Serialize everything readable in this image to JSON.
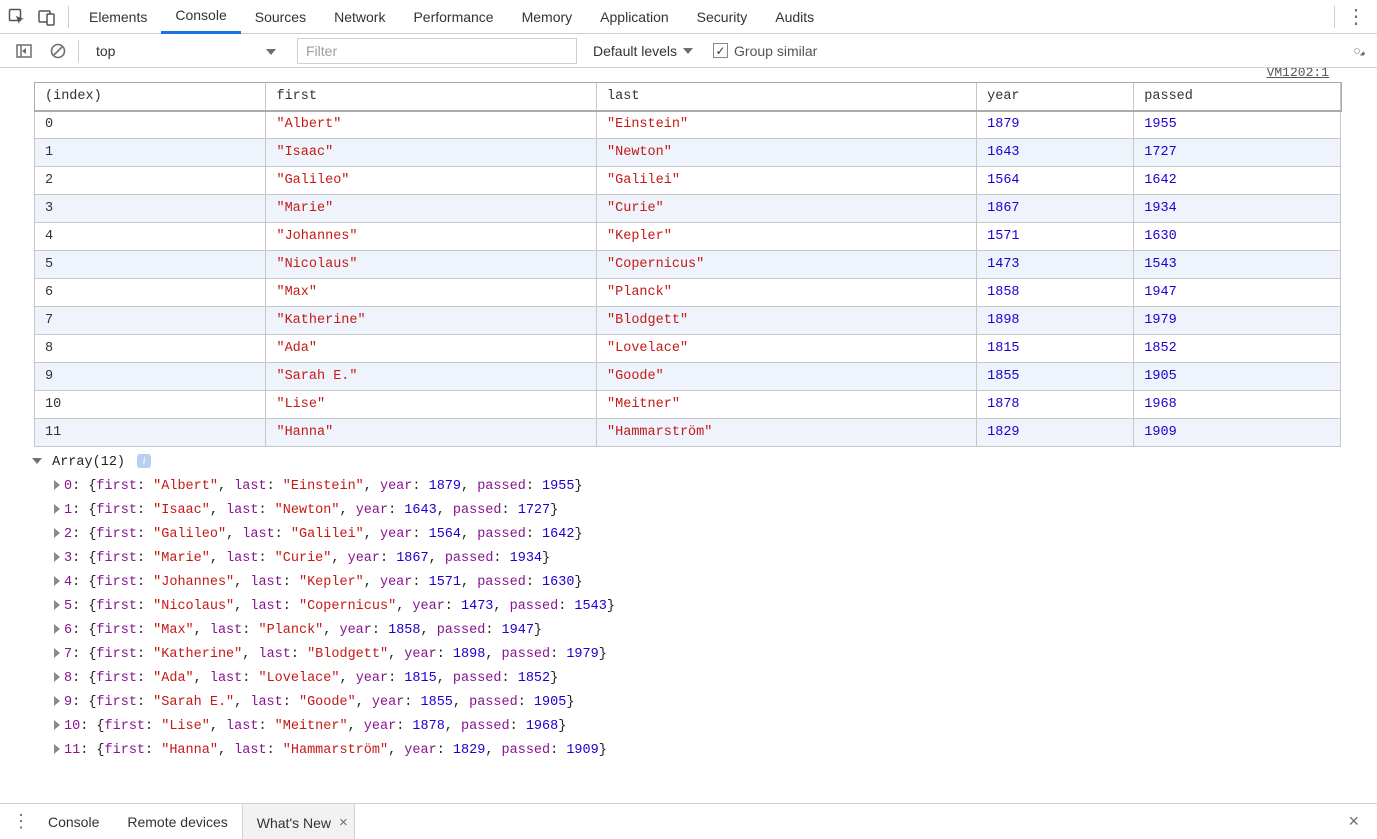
{
  "main_tabs": [
    "Elements",
    "Console",
    "Sources",
    "Network",
    "Performance",
    "Memory",
    "Application",
    "Security",
    "Audits"
  ],
  "main_tabs_active": 1,
  "toolbar": {
    "context": "top",
    "filter_placeholder": "Filter",
    "levels_label": "Default levels",
    "group_similar_label": "Group similar",
    "group_similar_checked": true
  },
  "source_link": "VM1202:1",
  "table": {
    "columns": [
      "(index)",
      "first",
      "last",
      "year",
      "passed"
    ],
    "rows": [
      {
        "index": 0,
        "first": "Albert",
        "last": "Einstein",
        "year": 1879,
        "passed": 1955
      },
      {
        "index": 1,
        "first": "Isaac",
        "last": "Newton",
        "year": 1643,
        "passed": 1727
      },
      {
        "index": 2,
        "first": "Galileo",
        "last": "Galilei",
        "year": 1564,
        "passed": 1642
      },
      {
        "index": 3,
        "first": "Marie",
        "last": "Curie",
        "year": 1867,
        "passed": 1934
      },
      {
        "index": 4,
        "first": "Johannes",
        "last": "Kepler",
        "year": 1571,
        "passed": 1630
      },
      {
        "index": 5,
        "first": "Nicolaus",
        "last": "Copernicus",
        "year": 1473,
        "passed": 1543
      },
      {
        "index": 6,
        "first": "Max",
        "last": "Planck",
        "year": 1858,
        "passed": 1947
      },
      {
        "index": 7,
        "first": "Katherine",
        "last": "Blodgett",
        "year": 1898,
        "passed": 1979
      },
      {
        "index": 8,
        "first": "Ada",
        "last": "Lovelace",
        "year": 1815,
        "passed": 1852
      },
      {
        "index": 9,
        "first": "Sarah E.",
        "last": "Goode",
        "year": 1855,
        "passed": 1905
      },
      {
        "index": 10,
        "first": "Lise",
        "last": "Meitner",
        "year": 1878,
        "passed": 1968
      },
      {
        "index": 11,
        "first": "Hanna",
        "last": "Hammarström",
        "year": 1829,
        "passed": 1909
      }
    ]
  },
  "array_label": "Array(12)",
  "field_keys": [
    "first",
    "last",
    "year",
    "passed"
  ],
  "drawer": {
    "tabs": [
      "Console",
      "Remote devices",
      "What's New"
    ],
    "active": 2
  },
  "icons": {
    "info": "i",
    "check": "✓",
    "more": "⋮",
    "close": "×"
  }
}
